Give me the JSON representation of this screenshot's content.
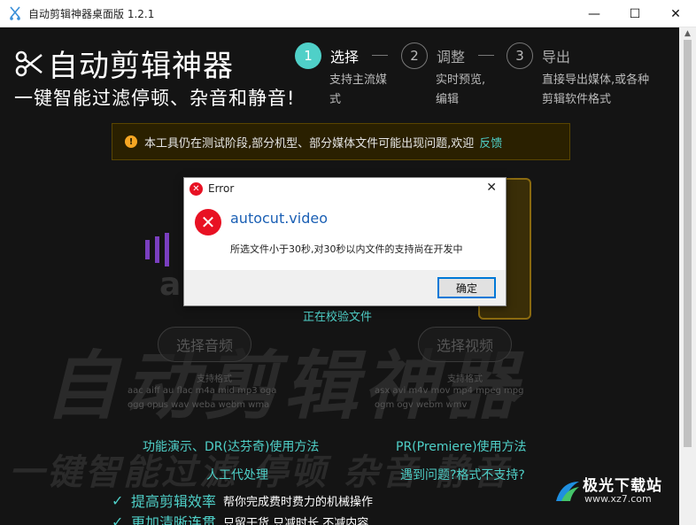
{
  "window": {
    "title": "自动剪辑神器桌面版 1.2.1",
    "minimize_glyph": "—",
    "maximize_glyph": "☐",
    "close_glyph": "✕"
  },
  "header": {
    "logo_title": "自动剪辑神器",
    "tagline": "一键智能过滤停顿、杂音和静音!"
  },
  "steps": [
    {
      "number": "1",
      "name": "选择",
      "desc_lines": [
        "支持主流媒",
        "式"
      ],
      "active": true
    },
    {
      "number": "2",
      "name": "调整",
      "desc_lines": [
        "实时预览,",
        "编辑"
      ],
      "active": false
    },
    {
      "number": "3",
      "name": "导出",
      "desc_lines": [
        "直接导出媒体,或各种",
        "剪辑软件格式"
      ],
      "active": false
    }
  ],
  "notice": {
    "icon": "!",
    "text": "本工具仍在测试阶段,部分机型、部分媒体文件可能出现问题,欢迎",
    "link": "反馈"
  },
  "main": {
    "deco_a": "a",
    "checking_text": "正在校验文件",
    "audio_button": "选择音频",
    "video_button": "选择视频",
    "formats_label_audio": "支持格式",
    "formats_label_video": "支持格式",
    "audio_formats_line1": "aac aiff au flac m4a mid mp3 oga",
    "audio_formats_line2": "ogg opus wav weba webm wma",
    "video_formats_line1": "asx avi m4v mov mp4 mpeg mpg",
    "video_formats_line2": "ogm ogv webm wmv",
    "watermark_big": "自动剪辑神器",
    "watermark_row2": "一键智能过滤 停顿 杂音 静音"
  },
  "links": {
    "demo_dr": "功能演示、DR(达芬奇)使用方法",
    "pr_usage": "PR(Premiere)使用方法",
    "manual": "人工代处理",
    "issue": "遇到问题?格式不支持?"
  },
  "bullets": [
    {
      "title": "提高剪辑效率",
      "sub": "帮你完成费时费力的机械操作"
    },
    {
      "title": "更加清晰连贯",
      "sub": "只留干货,只减时长,不减内容"
    }
  ],
  "site_logo": {
    "name": "极光下载站",
    "url": "www.xz7.com"
  },
  "dialog": {
    "title": "Error",
    "heading": "autocut.video",
    "message": "所选文件小于30秒,对30秒以内文件的支持尚在开发中",
    "ok_label": "确定",
    "error_icon_glyph": "✕",
    "close_glyph": "✕"
  },
  "colors": {
    "accent": "#4fd0c8",
    "error": "#e81123",
    "notice_bg": "#2a2000",
    "warning": "#f5a623"
  }
}
